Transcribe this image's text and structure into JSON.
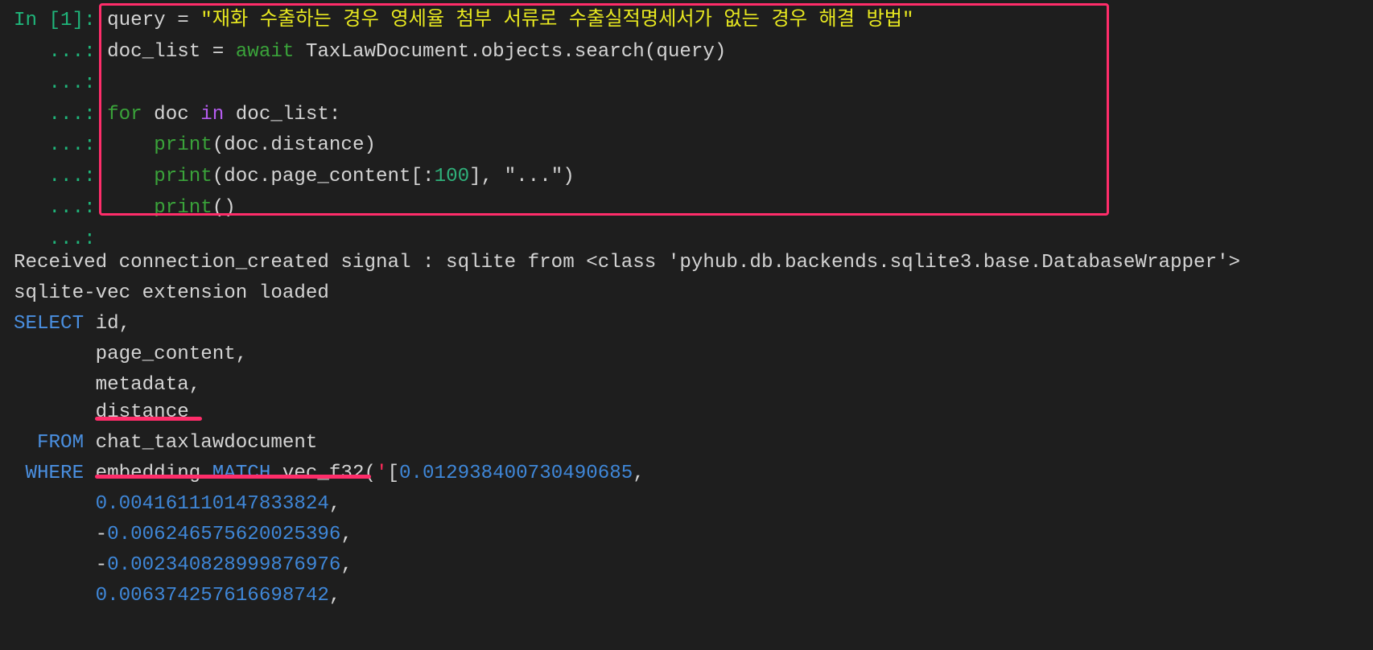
{
  "colors": {
    "background": "#1e1e1e",
    "highlight": "#ff2d6a",
    "prompt": "#1fb57a",
    "string": "#e8e820",
    "sql_keyword": "#4a8fe0"
  },
  "lines": [
    [
      [
        "prompt",
        "In [1]: "
      ],
      [
        "plain",
        "query = "
      ],
      [
        "str",
        "\"재화 수출하는 경우 영세율 첨부 서류로 수출실적명세서가 없는 경우 해결 방법\""
      ]
    ],
    [
      [
        "prompt",
        "   ...: "
      ],
      [
        "plain",
        "doc_list = "
      ],
      [
        "kw",
        "await"
      ],
      [
        "plain",
        " TaxLawDocument.objects.search(query)"
      ]
    ],
    [
      [
        "prompt",
        "   ...: "
      ]
    ],
    [
      [
        "prompt",
        "   ...: "
      ],
      [
        "kw",
        "for"
      ],
      [
        "plain",
        " doc "
      ],
      [
        "kin",
        "in"
      ],
      [
        "plain",
        " doc_list:"
      ]
    ],
    [
      [
        "prompt",
        "   ...: "
      ],
      [
        "plain",
        "    "
      ],
      [
        "fn",
        "print"
      ],
      [
        "plain",
        "(doc.distance)"
      ]
    ],
    [
      [
        "prompt",
        "   ...: "
      ],
      [
        "plain",
        "    "
      ],
      [
        "fn",
        "print"
      ],
      [
        "plain",
        "(doc.page_content[:"
      ],
      [
        "num",
        "100"
      ],
      [
        "plain",
        "], \"...\")"
      ]
    ],
    [
      [
        "prompt",
        "   ...: "
      ],
      [
        "plain",
        "    "
      ],
      [
        "fn",
        "print"
      ],
      [
        "plain",
        "()"
      ]
    ],
    [
      [
        "prompt",
        "   ...: "
      ]
    ],
    [
      [
        "plain",
        "Received connection_created signal : sqlite from <class 'pyhub.db.backends.sqlite3.base.DatabaseWrapper'>"
      ]
    ],
    [
      [
        "plain",
        "sqlite-vec extension loaded"
      ]
    ],
    [
      [
        "sqlkw",
        "SELECT"
      ],
      [
        "plain",
        " id,"
      ]
    ],
    [
      [
        "plain",
        "       page_content,"
      ]
    ],
    [
      [
        "plain",
        "       metadata,"
      ]
    ],
    [
      [
        "plain",
        "       distance"
      ]
    ],
    [
      [
        "sqlkw",
        "  FROM"
      ],
      [
        "plain",
        " chat_taxlawdocument"
      ]
    ],
    [
      [
        "sqlkw",
        " WHERE"
      ],
      [
        "plain",
        " embedding "
      ],
      [
        "sqlkw",
        "MATCH"
      ],
      [
        "plain",
        " vec_f32("
      ],
      [
        "redq",
        "'"
      ],
      [
        "plain",
        "["
      ],
      [
        "sqlnum",
        "0.012938400730490685"
      ],
      [
        "plain",
        ","
      ]
    ],
    [
      [
        "plain",
        "       "
      ],
      [
        "sqlnum",
        "0.004161110147833824"
      ],
      [
        "plain",
        ","
      ]
    ],
    [
      [
        "plain",
        "       -"
      ],
      [
        "sqlnum",
        "0.006246575620025396"
      ],
      [
        "plain",
        ","
      ]
    ],
    [
      [
        "plain",
        "       -"
      ],
      [
        "sqlnum",
        "0.002340828999876976"
      ],
      [
        "plain",
        ","
      ]
    ],
    [
      [
        "plain",
        "       "
      ],
      [
        "sqlnum",
        "0.006374257616698742"
      ],
      [
        "plain",
        ","
      ]
    ]
  ]
}
